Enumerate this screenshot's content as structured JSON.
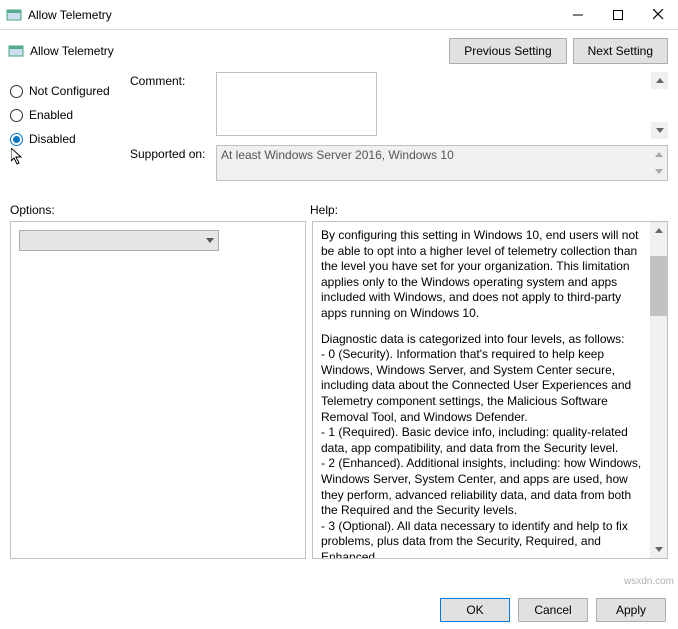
{
  "window": {
    "title": "Allow Telemetry"
  },
  "header": {
    "title": "Allow Telemetry",
    "prev": "Previous Setting",
    "next": "Next Setting"
  },
  "radios": {
    "not_configured": "Not Configured",
    "enabled": "Enabled",
    "disabled": "Disabled",
    "selected": "disabled"
  },
  "fields": {
    "comment_label": "Comment:",
    "comment_value": "",
    "supported_label": "Supported on:",
    "supported_value": "At least Windows Server 2016, Windows 10"
  },
  "labels": {
    "options": "Options:",
    "help": "Help:"
  },
  "options": {
    "combo_value": ""
  },
  "help": {
    "p1": "By configuring this setting in Windows 10, end users will not be able to opt into a higher level of telemetry collection than the level you have set for your organization.  This limitation applies only to the Windows operating system and apps included with Windows, and does not apply to third-party apps running on Windows 10.",
    "p2": "Diagnostic data is categorized into four levels, as follows:",
    "p3": "  - 0 (Security). Information that's required to help keep Windows, Windows Server, and System Center secure, including data about the Connected User Experiences and Telemetry component settings, the Malicious Software Removal Tool, and Windows Defender.",
    "p4": "  - 1 (Required). Basic device info, including: quality-related data, app compatibility, and data from the Security level.",
    "p5": "  - 2 (Enhanced). Additional insights, including: how Windows, Windows Server, System Center, and apps are used, how they perform, advanced reliability data, and data from both the Required and the Security levels.",
    "p6": "  - 3 (Optional). All data necessary to identify and help to fix problems, plus data from the Security, Required, and Enhanced"
  },
  "footer": {
    "ok": "OK",
    "cancel": "Cancel",
    "apply": "Apply"
  },
  "watermark": "wsxdn.com"
}
